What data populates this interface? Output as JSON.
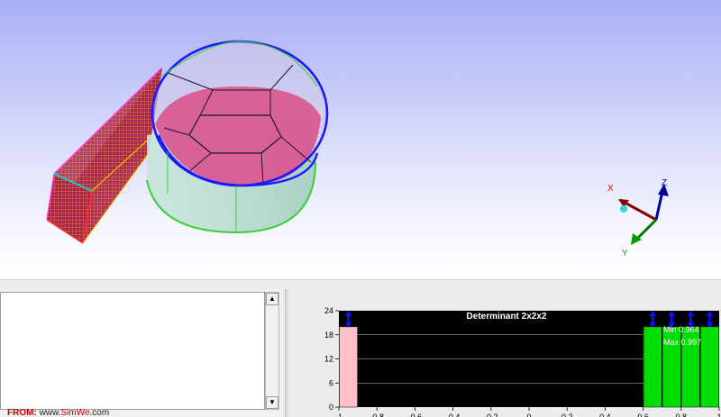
{
  "viewport": {
    "axes": {
      "x_label": "X",
      "y_label": "Y",
      "z_label": "Z"
    },
    "colors": {
      "bg_top": "#a8aef5",
      "mesh_fill": "#c2146f",
      "mesh_line": "#b8860b",
      "cylinder_side": "#b5d9cf",
      "cylinder_edge": "#1a1aff",
      "green_edge": "#39d13a"
    }
  },
  "log": {
    "content": "",
    "source_label": "FROM:",
    "source_prefix": "www.",
    "source_brand": "SimWe",
    "source_suffix": ".com"
  },
  "histogram": {
    "colors": {
      "background": "#000000",
      "bar_good": "#00dd00",
      "bar_bad": "#ffc0cb",
      "marker": "#1010ff",
      "grid": "#ffffff"
    }
  },
  "chart_data": {
    "type": "bar",
    "title": "Determinant 2x2x2",
    "xlabel": "",
    "ylabel": "",
    "xlim": [
      -1,
      1
    ],
    "ylim": [
      0,
      24
    ],
    "grid": true,
    "x_ticks": [
      "-1",
      "-0.8",
      "-0.6",
      "-0.4",
      "-0.2",
      "0",
      "0.2",
      "0.4",
      "0.6",
      "0.8",
      "1"
    ],
    "y_ticks": [
      "0",
      "6",
      "12",
      "18",
      "24"
    ],
    "bins": [
      {
        "x0": -1.0,
        "x1": -0.9,
        "value": 20,
        "color": "#ffc0cb"
      },
      {
        "x0": 0.6,
        "x1": 0.7,
        "value": 20,
        "color": "#00dd00"
      },
      {
        "x0": 0.7,
        "x1": 0.8,
        "value": 20,
        "color": "#00dd00"
      },
      {
        "x0": 0.8,
        "x1": 0.9,
        "value": 20,
        "color": "#00dd00"
      },
      {
        "x0": 0.9,
        "x1": 1.0,
        "value": 20,
        "color": "#00dd00"
      }
    ],
    "markers_x": [
      -0.95,
      0.65,
      0.75,
      0.85,
      0.95
    ],
    "annotations": {
      "min_text": "Min 0.964",
      "max_text": "Max 0.997"
    }
  }
}
